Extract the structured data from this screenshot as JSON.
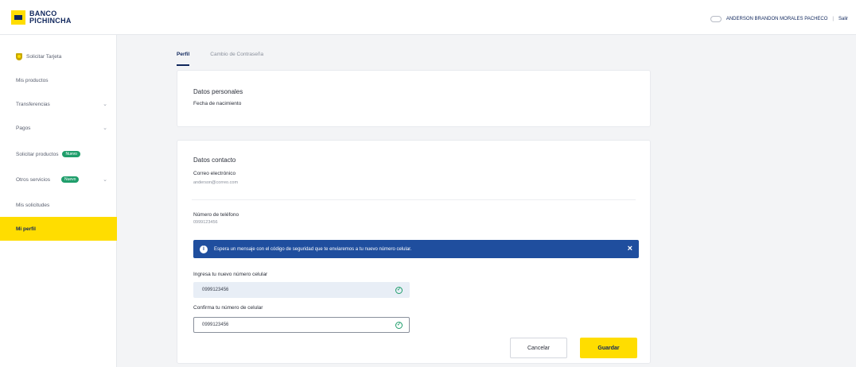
{
  "brand": {
    "line1": "BANCO",
    "line2": "PICHINCHA"
  },
  "user": {
    "name": "ANDERSON BRANDON MORALES PACHECO",
    "logout": "Salir"
  },
  "sidebar": {
    "items": [
      {
        "label": "Solicitar Tarjeta"
      },
      {
        "label": "Mis productos"
      },
      {
        "label": "Transferencias"
      },
      {
        "label": "Pagos"
      },
      {
        "label": "Solicitar productos",
        "badge": "Nuevo"
      },
      {
        "label": "Otros servicios",
        "badge": "Nuevo"
      },
      {
        "label": "Mis solicitudes"
      },
      {
        "label": "Mi perfil"
      }
    ]
  },
  "tabs": [
    {
      "label": "Perfil"
    },
    {
      "label": "Cambio de Contraseña"
    }
  ],
  "personal": {
    "title": "Datos personales",
    "birth_label": "Fecha de nacimiento"
  },
  "contact": {
    "title": "Datos contacto",
    "email_label": "Correo electrónico",
    "email_value": "anderson@correo.com",
    "phone_label": "Número de teléfono",
    "phone_value": "0999123456"
  },
  "alert": {
    "text": "Espera un mensaje con el código de seguridad que te enviaremos a tu nuevo número celular."
  },
  "form": {
    "new_phone_label": "Ingresa tu nuevo número celular",
    "new_phone_value": "0999123456",
    "confirm_label": "Confirma tu número de celular",
    "confirm_value": "0999123456"
  },
  "buttons": {
    "cancel": "Cancelar",
    "save": "Guardar"
  },
  "colors": {
    "brand_yellow": "#ffdd00",
    "brand_navy": "#0f265c",
    "alert_blue": "#1f4e9e",
    "success_green": "#1f9e6b"
  }
}
